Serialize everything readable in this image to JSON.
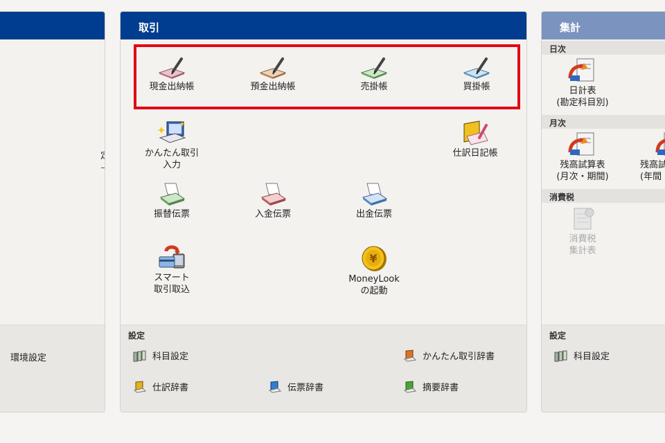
{
  "left_panel": {
    "partial_text_1": "定",
    "partial_text_2": "ー",
    "footer_item": "環境設定"
  },
  "transactions": {
    "title": "取引",
    "tiles": [
      {
        "label": "現金出納帳",
        "icon": "cash-book-icon",
        "color": "#c27a8a"
      },
      {
        "label": "預金出納帳",
        "icon": "bank-book-icon",
        "color": "#c08a5b"
      },
      {
        "label": "売掛帳",
        "icon": "receivable-book-icon",
        "color": "#6ea865"
      },
      {
        "label": "買掛帳",
        "icon": "payable-book-icon",
        "color": "#6aa5c8"
      },
      {
        "label": "かんたん取引\n入力",
        "icon": "easy-entry-icon"
      },
      {
        "label": "仕訳日記帳",
        "icon": "journal-icon"
      },
      {
        "label": "振替伝票",
        "icon": "transfer-slip-icon",
        "color": "#6ea865"
      },
      {
        "label": "入金伝票",
        "icon": "receipt-slip-icon",
        "color": "#c06060"
      },
      {
        "label": "出金伝票",
        "icon": "payment-slip-icon",
        "color": "#5b8ec8"
      },
      {
        "label": "スマート\n取引取込",
        "icon": "smart-import-icon"
      },
      {
        "label": "MoneyLook\nの起動",
        "icon": "moneylook-coin-icon"
      }
    ],
    "settings_label": "設定",
    "settings": [
      {
        "label": "科目設定",
        "icon": "account-settings-icon"
      },
      {
        "label": "かんたん取引辞書",
        "icon": "easy-dict-icon",
        "color": "#d9742a"
      },
      {
        "label": "仕訳辞書",
        "icon": "journal-dict-icon",
        "color": "#e0b21e"
      },
      {
        "label": "伝票辞書",
        "icon": "slip-dict-icon",
        "color": "#2f7fd0"
      },
      {
        "label": "摘要辞書",
        "icon": "summary-dict-icon",
        "color": "#4aa33a"
      }
    ]
  },
  "aggregate": {
    "title": "集計",
    "daily_label": "日次",
    "daily_tile": "日計表\n(勘定科目別)",
    "monthly_label": "月次",
    "monthly_tile_1": "残高試算表\n(月次・期間)",
    "monthly_tile_2": "残高試\n(年間",
    "tax_label": "消費税",
    "tax_tile": "消費税\n集計表",
    "settings_label": "設定",
    "settings_item": "科目設定"
  }
}
